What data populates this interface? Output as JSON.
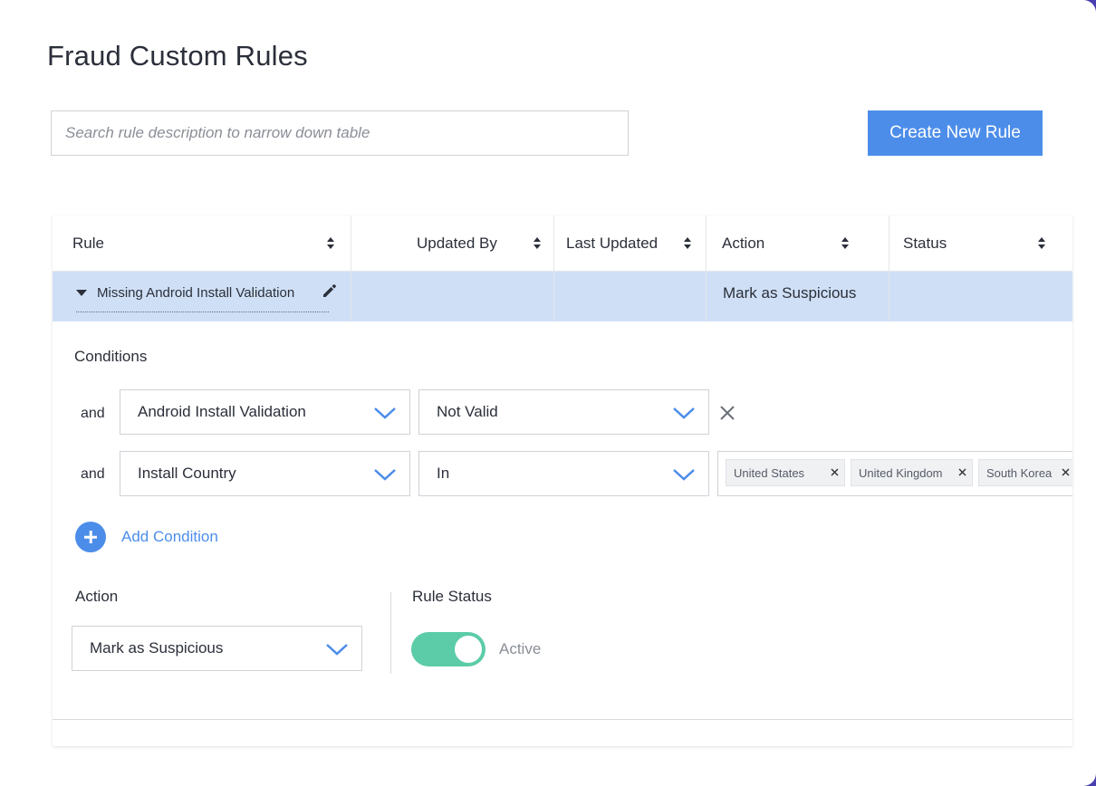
{
  "page": {
    "title": "Fraud Custom Rules"
  },
  "toolbar": {
    "search_placeholder": "Search rule description to narrow down table",
    "create_label": "Create New Rule"
  },
  "table": {
    "columns": [
      "Rule",
      "Updated By",
      "Last Updated",
      "Action",
      "Status"
    ],
    "rows": [
      {
        "rule": "Missing Android Install Validation",
        "updated_by": "",
        "last_updated": "",
        "action": "Mark as Suspicious",
        "status": ""
      }
    ]
  },
  "details": {
    "conditions_label": "Conditions",
    "conditions": [
      {
        "conjunction": "and",
        "field": "Android Install Validation",
        "operator": "Not Valid"
      },
      {
        "conjunction": "and",
        "field": "Install Country",
        "operator": "In",
        "values": [
          "United States",
          "United Kingdom",
          "South Korea"
        ]
      }
    ],
    "add_condition_label": "Add Condition",
    "action_label": "Action",
    "action_value": "Mark as Suspicious",
    "rule_status_label": "Rule Status",
    "rule_status_value": "Active"
  },
  "colors": {
    "accent": "#4c8de9",
    "selected_row": "#cfe0f6",
    "toggle_on": "#5ccba8"
  },
  "icons": [
    "sort-icon",
    "caret-down-icon",
    "pencil-icon",
    "chevron-down-icon",
    "close-icon",
    "plus-circle-icon"
  ]
}
